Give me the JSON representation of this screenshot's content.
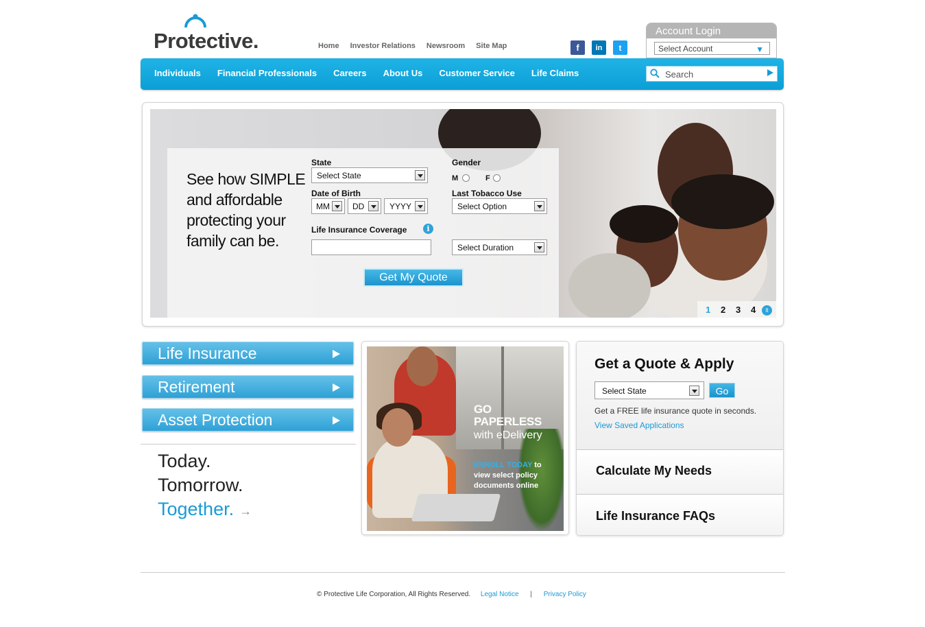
{
  "brand": {
    "name": "Protective.",
    "accent": "#1a9ad6"
  },
  "topnav": [
    "Home",
    "Investor Relations",
    "Newsroom",
    "Site Map"
  ],
  "social": [
    {
      "icon": "facebook-icon",
      "glyph": "f"
    },
    {
      "icon": "linkedin-icon",
      "glyph": "in"
    },
    {
      "icon": "twitter-icon",
      "glyph": "t"
    }
  ],
  "account_login": {
    "title": "Account Login",
    "select": "Select Account"
  },
  "mainnav": [
    "Individuals",
    "Financial Professionals",
    "Careers",
    "About Us",
    "Customer Service",
    "Life Claims"
  ],
  "search": {
    "placeholder": "Search"
  },
  "hero": {
    "headline": "See how SIMPLE and affordable protecting your family can be.",
    "state_label": "State",
    "state_select": "Select State",
    "gender_label": "Gender",
    "gender_m": "M",
    "gender_f": "F",
    "dob_label": "Date of Birth",
    "dob_mm": "MM",
    "dob_dd": "DD",
    "dob_yyyy": "YYYY",
    "tobacco_label": "Last Tobacco Use",
    "tobacco_select": "Select Option",
    "coverage_label": "Life Insurance Coverage",
    "info_glyph": "i",
    "duration_select": "Select Duration",
    "quote_button": "Get My Quote",
    "pager": [
      "1",
      "2",
      "3",
      "4"
    ],
    "pager_active": "1",
    "pause_glyph": "II"
  },
  "left_buttons": [
    "Life Insurance",
    "Retirement",
    "Asset Protection"
  ],
  "tagline": {
    "line1": "Today.",
    "line2": "Tomorrow.",
    "line3": "Together.",
    "arrow": "→"
  },
  "promo": {
    "title_line1": "GO",
    "title_line2": "PAPERLESS",
    "title_line3": "with eDelivery",
    "enroll_hl": "ENROLL TODAY",
    "enroll_rest": " to view select policy documents online"
  },
  "quote_panel": {
    "title": "Get a Quote & Apply",
    "select_state": "Select State",
    "go": "Go",
    "free_text": "Get a FREE life insurance quote in seconds.",
    "saved_link": "View Saved Applications",
    "calc": "Calculate My Needs",
    "faq": "Life Insurance FAQs"
  },
  "footer": {
    "copyright": "© Protective Life Corporation, All Rights Reserved.",
    "legal": "Legal Notice",
    "separator": "|",
    "privacy": "Privacy Policy"
  }
}
